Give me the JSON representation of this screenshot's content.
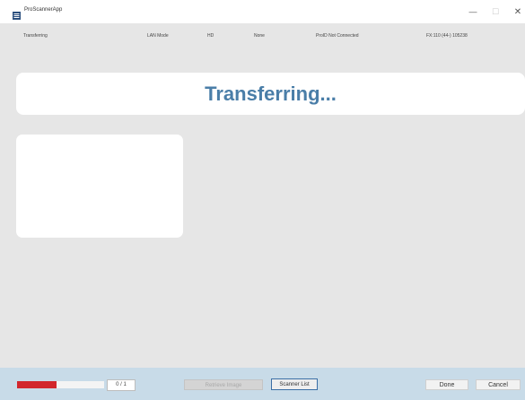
{
  "window": {
    "title": "ProScannerApp",
    "minimize": "—",
    "maximize": "☐",
    "close": "✕"
  },
  "status": {
    "state": "Transferring",
    "mode": "LAN Mode",
    "quality": "HD",
    "option": "None",
    "connection": "ProID Not Connected",
    "device_id": "FX:110 (44-) 105238"
  },
  "banner": {
    "message": "Transferring..."
  },
  "bottom": {
    "counter": "0 / 1",
    "progress_fraction": 0.45,
    "retrieve_label": "Retrieve Image",
    "scanner_list_label": "Scanner List",
    "done_label": "Done",
    "cancel_label": "Cancel"
  },
  "colors": {
    "accent_text": "#4a7ea8",
    "progress": "#d2262c",
    "bottom_bar": "#c8dbe8",
    "background": "#e6e6e6"
  }
}
